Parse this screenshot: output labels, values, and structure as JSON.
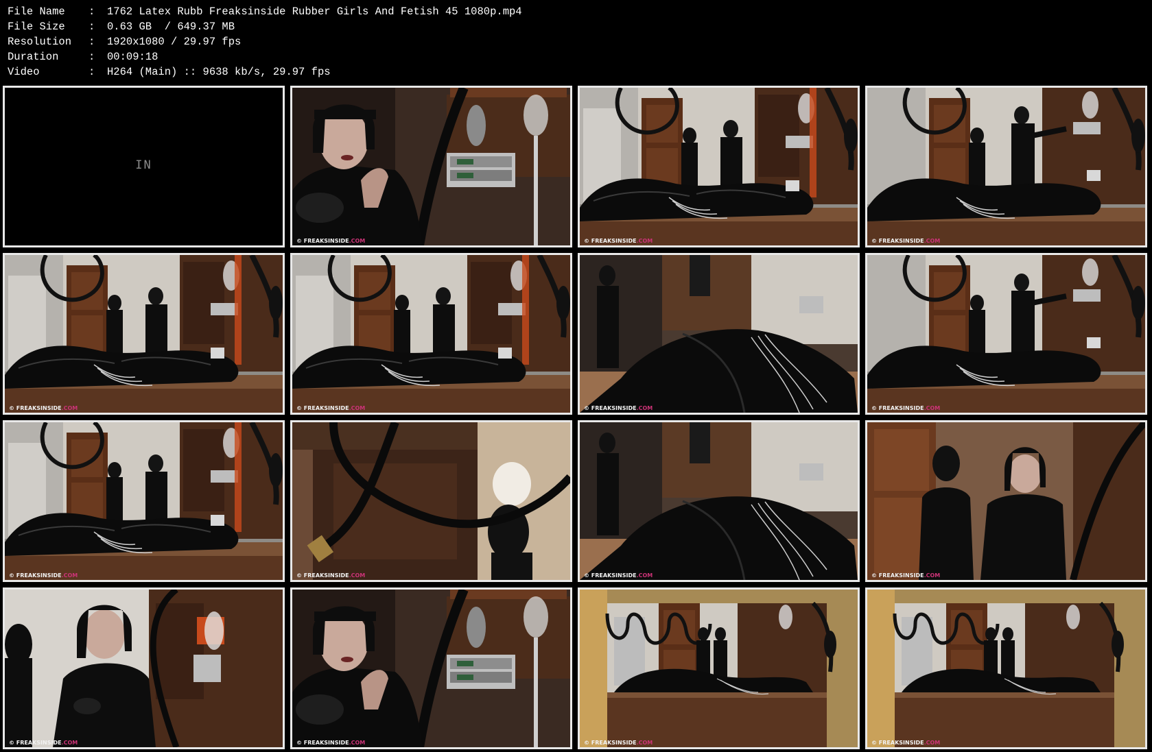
{
  "info": {
    "rows": [
      {
        "key": "File Name",
        "sep": ":",
        "value": "1762 Latex Rubb Freaksinside Rubber Girls And Fetish 45 1080p.mp4"
      },
      {
        "key": "File Size",
        "sep": ":",
        "value": "0.63 GB  / 649.37 MB"
      },
      {
        "key": "Resolution",
        "sep": ":",
        "value": "1920x1080 / 29.97 fps"
      },
      {
        "key": "Duration",
        "sep": ":",
        "value": "00:09:18"
      },
      {
        "key": "Video",
        "sep": ":",
        "value": "H264 (Main) :: 9638 kb/s, 29.97 fps"
      }
    ]
  },
  "intro_text": "IN",
  "watermark": {
    "prefix": "© ",
    "brand": "FREAKSINSIDE",
    "suffix": ".COM"
  },
  "colors": {
    "background": "#000000",
    "text": "#ffffff",
    "thumb_border": "#e8e8e8",
    "latex": "#0b0b0b",
    "wood": "#5a2e17",
    "wall": "#cfcac2",
    "counter": "#7a5236"
  },
  "thumbnails": [
    {
      "scene": "black-intro"
    },
    {
      "scene": "closeup-woman-pump"
    },
    {
      "scene": "room-wide-bag"
    },
    {
      "scene": "room-wide-bag-right"
    },
    {
      "scene": "room-wide-bag"
    },
    {
      "scene": "room-wide-bag"
    },
    {
      "scene": "room-angle-bag"
    },
    {
      "scene": "room-wide-bag-right"
    },
    {
      "scene": "room-wide-bag"
    },
    {
      "scene": "hose-closeup"
    },
    {
      "scene": "room-angle-bag"
    },
    {
      "scene": "two-figures-medium"
    },
    {
      "scene": "woman-closeup-left"
    },
    {
      "scene": "closeup-woman-pump"
    },
    {
      "scene": "room-far-wide"
    },
    {
      "scene": "room-far-wide"
    }
  ]
}
